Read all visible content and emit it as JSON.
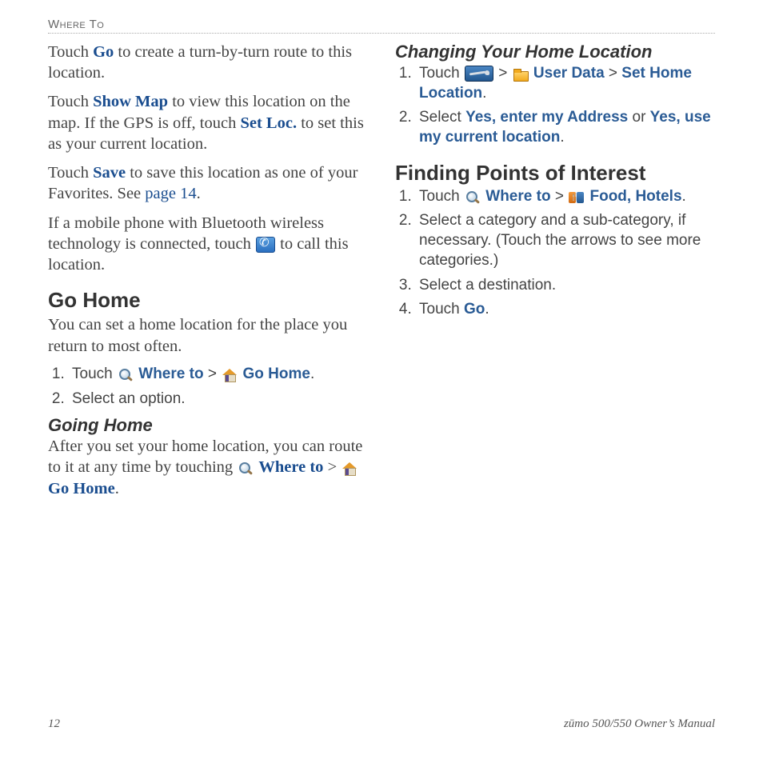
{
  "header": "Where To",
  "left": {
    "p1": {
      "pre": "Touch ",
      "go": "Go",
      "post": " to create a turn-by-turn route to this location."
    },
    "p2": {
      "pre": "Touch ",
      "showmap": "Show Map",
      "mid": " to view this location on the map. If the GPS is off, touch ",
      "setloc": "Set Loc.",
      "post": " to set this as your current location."
    },
    "p3": {
      "pre": "Touch ",
      "save": "Save",
      "mid": " to save this location as one of your Favorites. See ",
      "pageref": "page 14",
      "post": "."
    },
    "p4": {
      "pre": "If a mobile phone with Bluetooth wireless technology is connected, touch ",
      "post": " to call this location."
    },
    "h_gohome": "Go Home",
    "p5": "You can set a home location for the place you return to most often.",
    "ol1": {
      "i1": {
        "pre": "Touch ",
        "whereto": "Where to",
        "sep": " > ",
        "gohome": "Go Home",
        "post": "."
      },
      "i2": "Select an option."
    },
    "h_goinghome": "Going Home",
    "p6": {
      "pre": "After you set your home location, you can route to it at any time by touching ",
      "whereto": "Where to",
      "sep": " > ",
      "gohome": "Go Home",
      "post": "."
    }
  },
  "right": {
    "h_change": "Changing Your Home Location",
    "ol1": {
      "i1": {
        "pre": "Touch ",
        "sep1": " > ",
        "userdata": "User Data",
        "sep2": " > ",
        "sethome": "Set Home Location",
        "post": "."
      },
      "i2": {
        "pre": "Select ",
        "opt1": "Yes, enter my Address",
        "or": " or ",
        "opt2": "Yes, use my current location",
        "post": "."
      }
    },
    "h_poi": "Finding Points of Interest",
    "ol2": {
      "i1": {
        "pre": "Touch ",
        "whereto": "Where to",
        "sep": " > ",
        "food": "Food, Hotels",
        "post": "."
      },
      "i2": "Select a category and a sub-category, if necessary. (Touch the arrows to see more categories.)",
      "i3": "Select a destination.",
      "i4": {
        "pre": "Touch ",
        "go": "Go",
        "post": "."
      }
    }
  },
  "footer": {
    "page": "12",
    "manual": "zūmo 500/550 Owner’s Manual"
  }
}
